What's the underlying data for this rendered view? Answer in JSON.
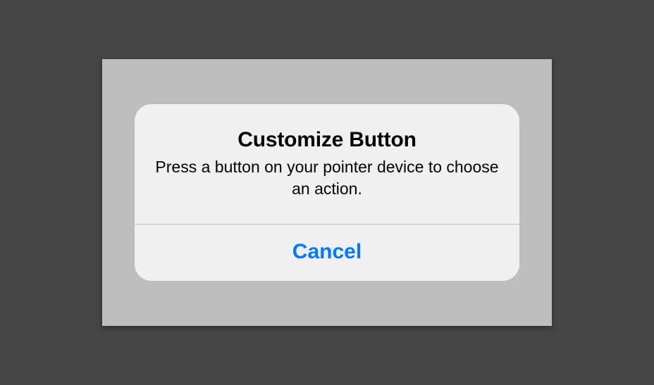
{
  "alert": {
    "title": "Customize Button",
    "message": "Press a button on your pointer device to choose an action.",
    "cancel_label": "Cancel"
  }
}
